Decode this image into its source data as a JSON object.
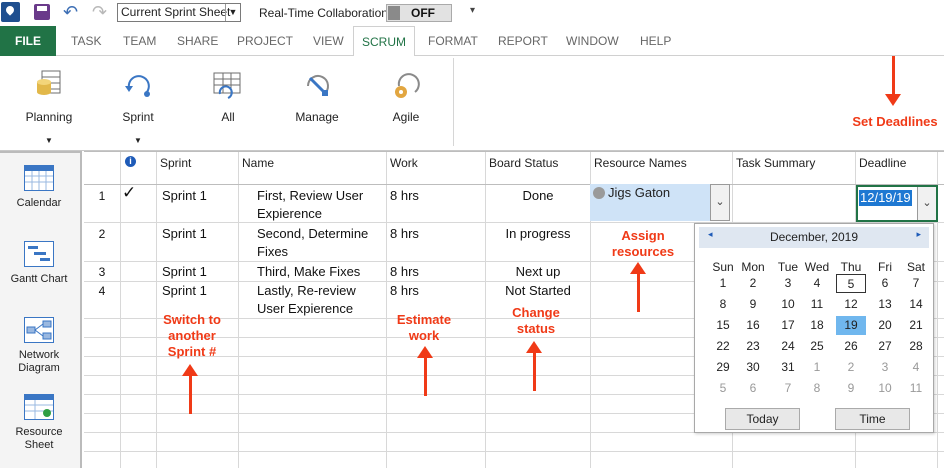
{
  "quick_access": {
    "view_select": "Current Sprint Sheet",
    "collab_label": "Real-Time Collaboration",
    "collab_state": "OFF",
    "more": "▾"
  },
  "tabs": [
    {
      "label": "FILE"
    },
    {
      "label": "TASK"
    },
    {
      "label": "TEAM"
    },
    {
      "label": "SHARE"
    },
    {
      "label": "PROJECT"
    },
    {
      "label": "VIEW"
    },
    {
      "label": "SCRUM"
    },
    {
      "label": "FORMAT"
    },
    {
      "label": "REPORT"
    },
    {
      "label": "WINDOW"
    },
    {
      "label": "HELP"
    }
  ],
  "active_tab": "SCRUM",
  "ribbon": {
    "planning": "Planning",
    "sprint": "Sprint",
    "all": "All",
    "manage": "Manage",
    "agile": "Agile"
  },
  "viewbar": {
    "calendar": "Calendar",
    "gantt": "Gantt Chart",
    "network": "Network Diagram",
    "resource": "Resource Sheet"
  },
  "columns": {
    "info": "i",
    "sprint": "Sprint",
    "name": "Name",
    "work": "Work",
    "board_status": "Board Status",
    "resource_names": "Resource Names",
    "task_summary": "Task Summary",
    "deadline": "Deadline"
  },
  "rows": [
    {
      "id": "1",
      "check": "✓",
      "sprint": "Sprint 1",
      "name": "First, Review User Expierence",
      "work": "8 hrs",
      "status": "Done",
      "resource": "Jigs Gaton",
      "deadline": "12/19/19"
    },
    {
      "id": "2",
      "check": "",
      "sprint": "Sprint 1",
      "name": "Second, Determine Fixes",
      "work": "8 hrs",
      "status": "In progress",
      "resource": "",
      "deadline": ""
    },
    {
      "id": "3",
      "check": "",
      "sprint": "Sprint 1",
      "name": "Third, Make Fixes",
      "work": "8 hrs",
      "status": "Next up",
      "resource": "",
      "deadline": ""
    },
    {
      "id": "4",
      "check": "",
      "sprint": "Sprint 1",
      "name": "Lastly, Re-review User Expierence",
      "work": "8 hrs",
      "status": "Not Started",
      "resource": "",
      "deadline": ""
    }
  ],
  "calendar": {
    "month": "December, 2019",
    "prev": "◂",
    "next": "▸",
    "dow": [
      "Sun",
      "Mon",
      "Tue",
      "Wed",
      "Thu",
      "Fri",
      "Sat"
    ],
    "weeks": [
      [
        "1",
        "2",
        "3",
        "4",
        "5",
        "6",
        "7"
      ],
      [
        "8",
        "9",
        "10",
        "11",
        "12",
        "13",
        "14"
      ],
      [
        "15",
        "16",
        "17",
        "18",
        "19",
        "20",
        "21"
      ],
      [
        "22",
        "23",
        "24",
        "25",
        "26",
        "27",
        "28"
      ],
      [
        "29",
        "30",
        "31",
        "1",
        "2",
        "3",
        "4"
      ],
      [
        "5",
        "6",
        "7",
        "8",
        "9",
        "10",
        "11"
      ]
    ],
    "today_label": "Today",
    "time_label": "Time"
  },
  "annotations": {
    "deadlines": "Set Deadlines",
    "sprint": "Switch to another Sprint #",
    "work": "Estimate work",
    "status": "Change status",
    "resources": "Assign resources"
  },
  "colors": {
    "file_tab": "#217346",
    "selection": "#1e78d2",
    "annotation": "#f03a17"
  }
}
